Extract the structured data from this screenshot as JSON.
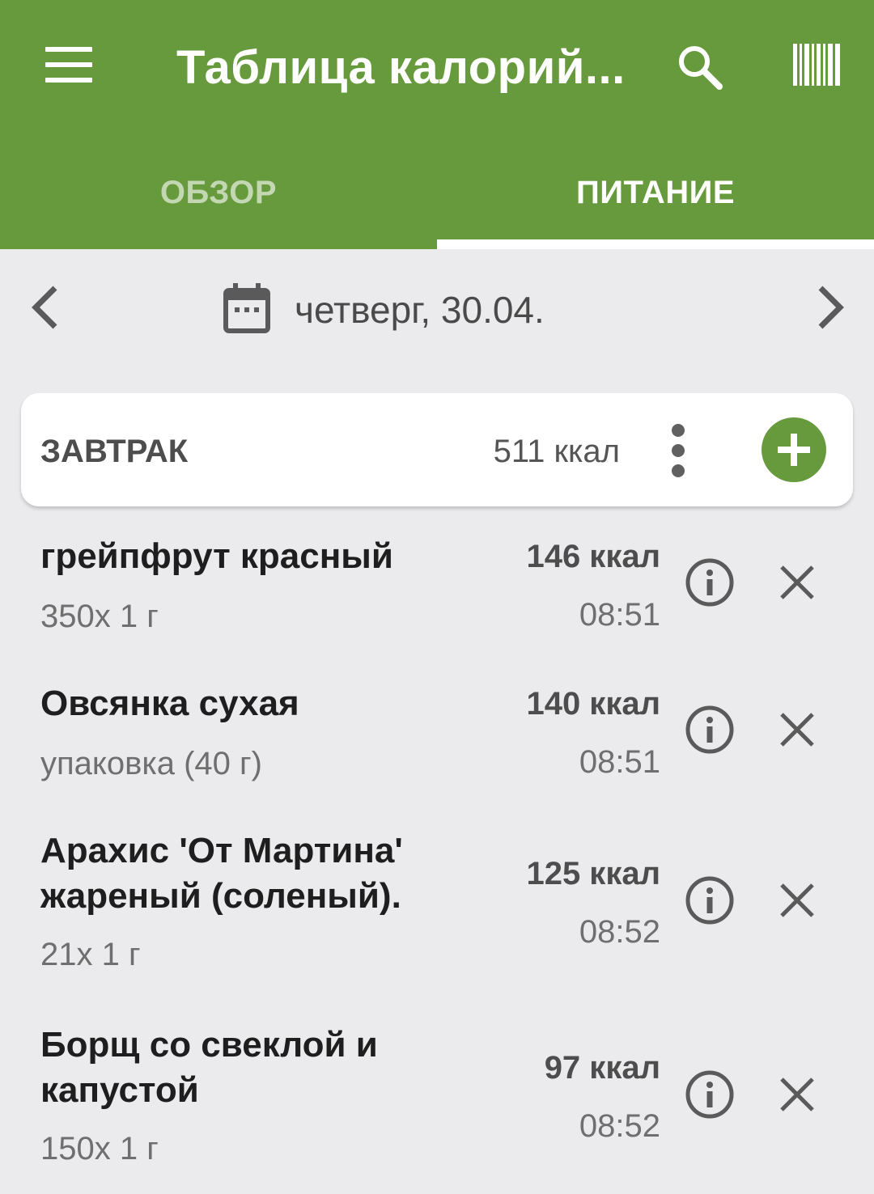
{
  "header": {
    "title": "Таблица калорий...",
    "menu_icon": "hamburger-menu-icon",
    "search_icon": "search-icon",
    "barcode_icon": "barcode-icon"
  },
  "tabs": [
    {
      "label": "ОБЗОР",
      "active": false
    },
    {
      "label": "ПИТАНИЕ",
      "active": true
    }
  ],
  "date_nav": {
    "date": "четверг, 30.04."
  },
  "meal": {
    "name": "ЗАВТРАК",
    "kcal": "511 ккал"
  },
  "items": [
    {
      "name": "грейпфрут красный",
      "portion": "350x 1 г",
      "kcal": "146 ккал",
      "time": "08:51"
    },
    {
      "name": "Овсянка сухая",
      "portion": "упаковка (40 г)",
      "kcal": "140 ккал",
      "time": "08:51"
    },
    {
      "name": "Арахис 'От Мартина' жареный (соленый).",
      "portion": "21x 1 г",
      "kcal": "125 ккал",
      "time": "08:52"
    },
    {
      "name": "Борщ со свеклой и капустой",
      "portion": "150x 1 г",
      "kcal": "97 ккал",
      "time": "08:52"
    }
  ],
  "colors": {
    "brand_green": "#669a3c",
    "background": "#ebebed",
    "tab_inactive": "#c3d7b2"
  }
}
